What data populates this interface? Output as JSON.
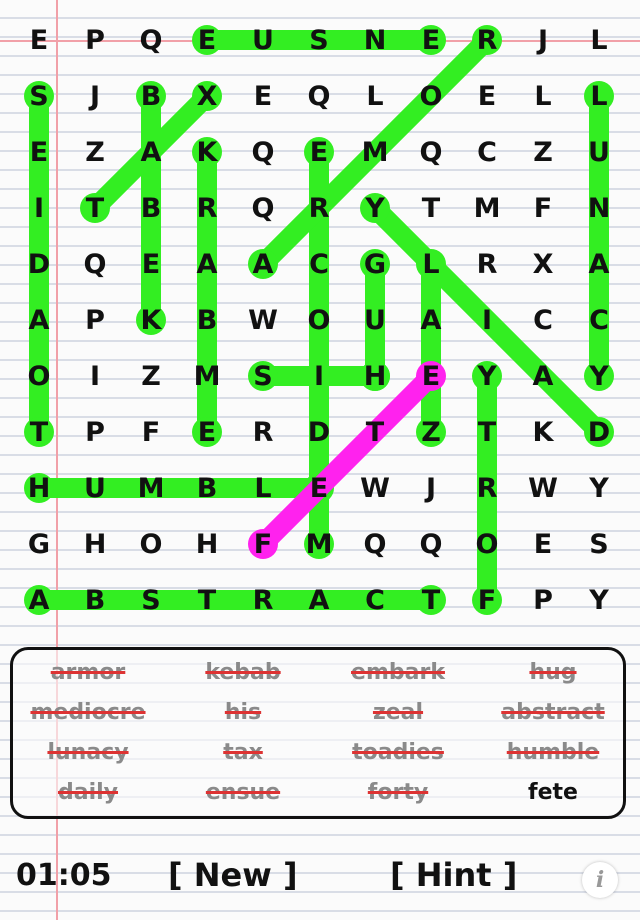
{
  "grid": {
    "rows": [
      [
        "E",
        "P",
        "Q",
        "E",
        "U",
        "S",
        "N",
        "E",
        "R",
        "J",
        "L"
      ],
      [
        "S",
        "J",
        "B",
        "X",
        "E",
        "Q",
        "L",
        "O",
        "E",
        "L",
        "L"
      ],
      [
        "E",
        "Z",
        "A",
        "K",
        "Q",
        "E",
        "M",
        "Q",
        "C",
        "Z",
        "U"
      ],
      [
        "I",
        "T",
        "B",
        "R",
        "Q",
        "R",
        "Y",
        "T",
        "M",
        "F",
        "N"
      ],
      [
        "D",
        "Q",
        "E",
        "A",
        "A",
        "C",
        "G",
        "L",
        "R",
        "X",
        "A"
      ],
      [
        "A",
        "P",
        "K",
        "B",
        "W",
        "O",
        "U",
        "A",
        "I",
        "C",
        "C"
      ],
      [
        "O",
        "I",
        "Z",
        "M",
        "S",
        "I",
        "H",
        "E",
        "Y",
        "A",
        "Y"
      ],
      [
        "T",
        "P",
        "F",
        "E",
        "R",
        "D",
        "T",
        "Z",
        "T",
        "K",
        "D"
      ],
      [
        "H",
        "U",
        "M",
        "B",
        "L",
        "E",
        "W",
        "J",
        "R",
        "W",
        "Y"
      ],
      [
        "G",
        "H",
        "O",
        "H",
        "F",
        "M",
        "Q",
        "Q",
        "O",
        "E",
        "S"
      ],
      [
        "A",
        "B",
        "S",
        "T",
        "R",
        "A",
        "C",
        "T",
        "F",
        "P",
        "Y"
      ]
    ],
    "found_color": "#33ee22",
    "current_color": "#ff22ee",
    "found_lines": [
      {
        "word": "ensue",
        "from": [
          0,
          3
        ],
        "to": [
          0,
          7
        ]
      },
      {
        "word": "daily",
        "from": [
          1,
          0
        ],
        "to": [
          7,
          0
        ]
      },
      {
        "word": "lunacy",
        "from": [
          1,
          10
        ],
        "to": [
          6,
          10
        ]
      },
      {
        "word": "tax",
        "from": [
          3,
          1
        ],
        "to": [
          1,
          3
        ]
      },
      {
        "word": "kebab",
        "from": [
          5,
          2
        ],
        "to": [
          1,
          2
        ]
      },
      {
        "word": "mediocre",
        "from": [
          9,
          5
        ],
        "to": [
          2,
          5
        ]
      },
      {
        "word": "armor",
        "from": [
          7,
          3
        ],
        "to": [
          2,
          3
        ]
      },
      {
        "word": "embark",
        "from": [
          0,
          8
        ],
        "to": [
          4,
          4
        ]
      },
      {
        "word": "toadies",
        "from": [
          3,
          6
        ],
        "to": [
          7,
          10
        ]
      },
      {
        "word": "hug",
        "from": [
          6,
          6
        ],
        "to": [
          4,
          6
        ]
      },
      {
        "word": "his",
        "from": [
          6,
          6
        ],
        "to": [
          6,
          4
        ]
      },
      {
        "word": "zeal",
        "from": [
          7,
          7
        ],
        "to": [
          4,
          7
        ]
      },
      {
        "word": "forty",
        "from": [
          10,
          8
        ],
        "to": [
          6,
          8
        ]
      },
      {
        "word": "humble",
        "from": [
          8,
          0
        ],
        "to": [
          8,
          5
        ]
      },
      {
        "word": "abstract",
        "from": [
          10,
          0
        ],
        "to": [
          10,
          7
        ]
      }
    ],
    "current_line": {
      "word": "fete",
      "from": [
        9,
        4
      ],
      "to": [
        6,
        7
      ]
    }
  },
  "words": [
    {
      "text": "armor",
      "found": true
    },
    {
      "text": "kebab",
      "found": true
    },
    {
      "text": "embark",
      "found": true
    },
    {
      "text": "hug",
      "found": true
    },
    {
      "text": "mediocre",
      "found": true
    },
    {
      "text": "his",
      "found": true
    },
    {
      "text": "zeal",
      "found": true
    },
    {
      "text": "abstract",
      "found": true
    },
    {
      "text": "lunacy",
      "found": true
    },
    {
      "text": "tax",
      "found": true
    },
    {
      "text": "toadies",
      "found": true
    },
    {
      "text": "humble",
      "found": true
    },
    {
      "text": "daily",
      "found": true
    },
    {
      "text": "ensue",
      "found": true
    },
    {
      "text": "forty",
      "found": true
    },
    {
      "text": "fete",
      "found": false
    }
  ],
  "footer": {
    "timer": "01:05",
    "new_label": "[ New ]",
    "hint_label": "[ Hint ]",
    "info_icon": "info-icon",
    "info_glyph": "i"
  }
}
